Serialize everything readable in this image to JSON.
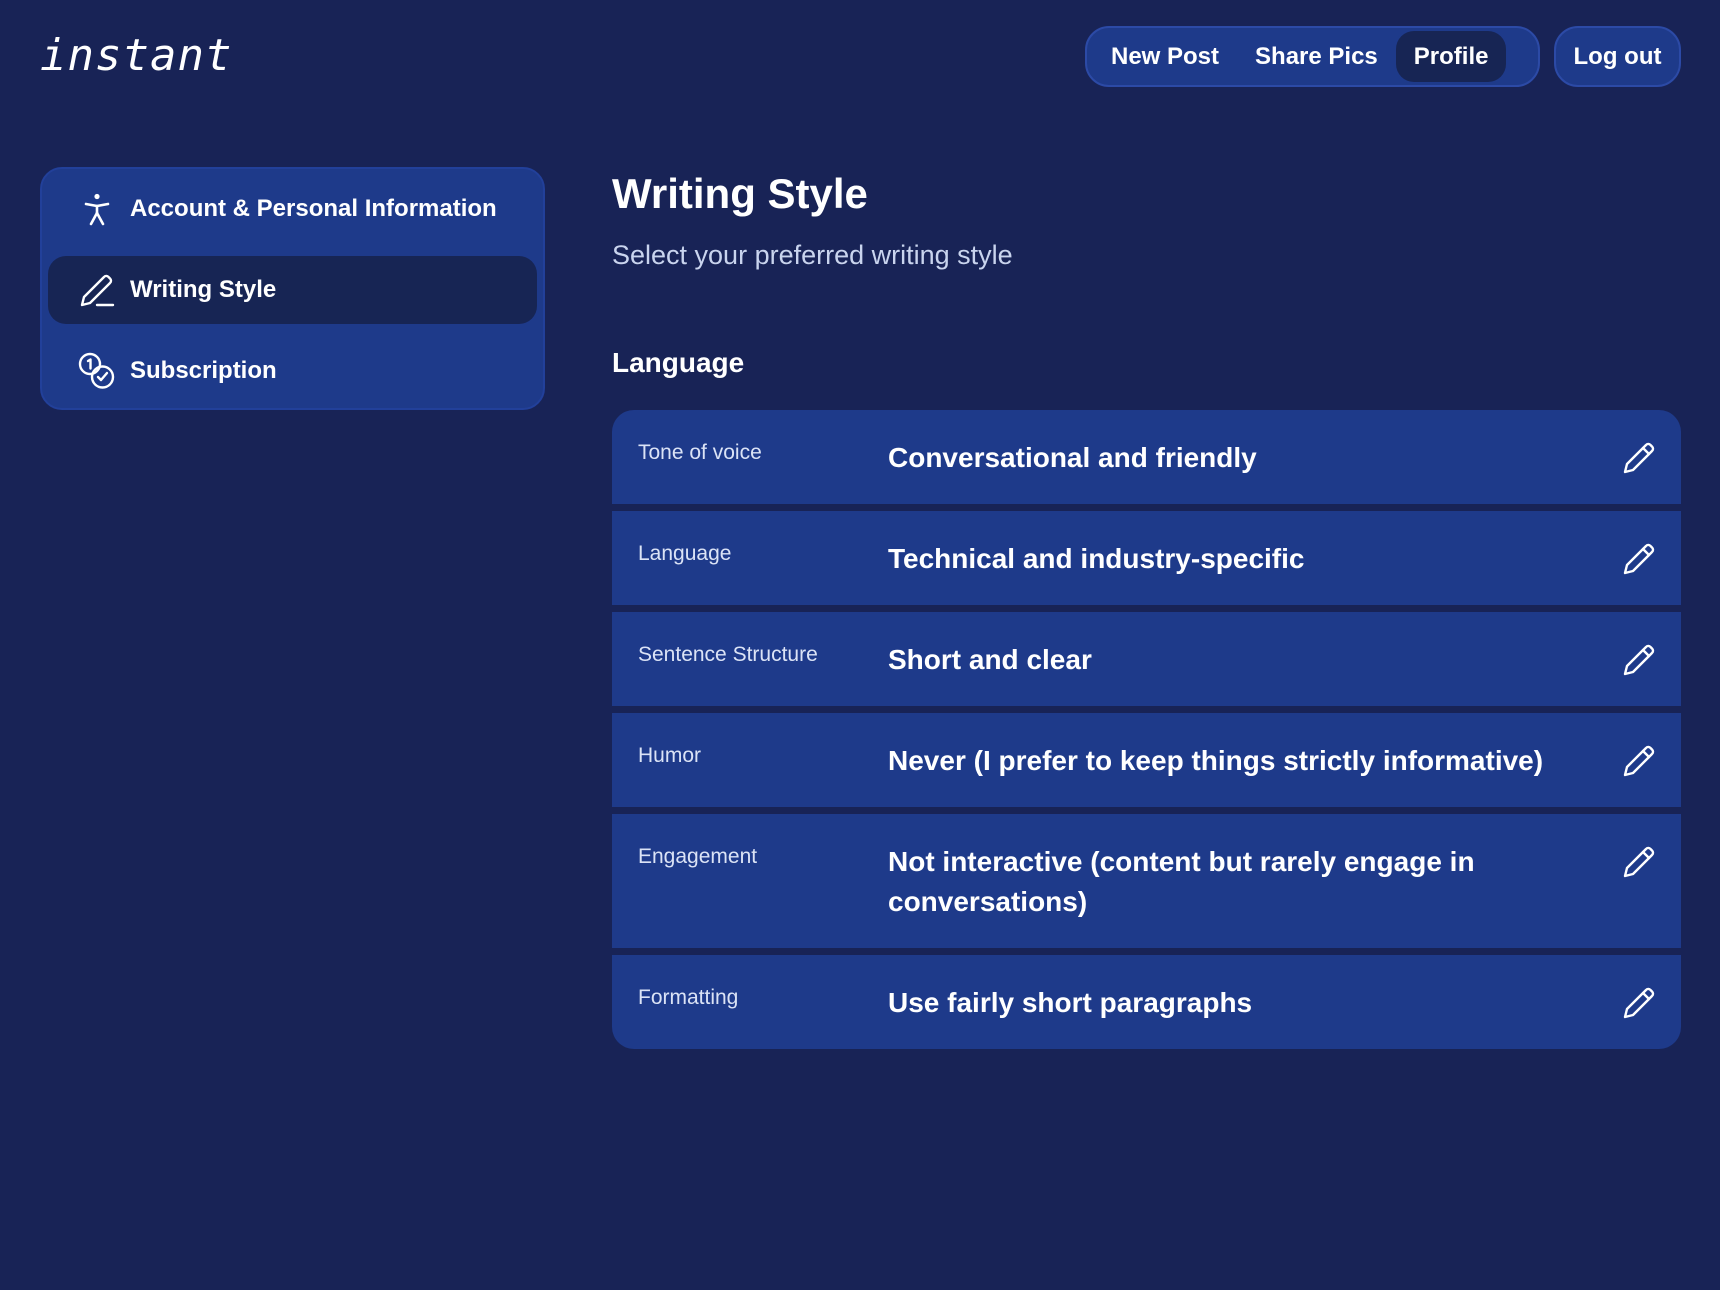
{
  "app": {
    "logo": "instant"
  },
  "topnav": {
    "items": [
      {
        "label": "New Post"
      },
      {
        "label": "Share Pics"
      },
      {
        "label": "Profile",
        "active": true
      }
    ],
    "logout": "Log out"
  },
  "sidebar": {
    "items": [
      {
        "label": "Account & Personal Information",
        "icon": "person-icon"
      },
      {
        "label": "Writing Style",
        "icon": "pen-icon",
        "active": true
      },
      {
        "label": "Subscription",
        "icon": "coins-icon"
      }
    ]
  },
  "main": {
    "title": "Writing Style",
    "subtitle": "Select your preferred writing style",
    "section": "Language",
    "settings": [
      {
        "label": "Tone of voice",
        "value": "Conversational and friendly"
      },
      {
        "label": "Language",
        "value": "Technical and industry-specific"
      },
      {
        "label": "Sentence Structure",
        "value": "Short and clear"
      },
      {
        "label": "Humor",
        "value": "Never (I prefer to keep things strictly informative)"
      },
      {
        "label": "Engagement",
        "value": "Not interactive (content but rarely engage in conversations)"
      },
      {
        "label": "Formatting",
        "value": "Use fairly short paragraphs"
      }
    ]
  },
  "colors": {
    "background": "#182356",
    "card": "#1e3a8a",
    "active": "#172554"
  }
}
